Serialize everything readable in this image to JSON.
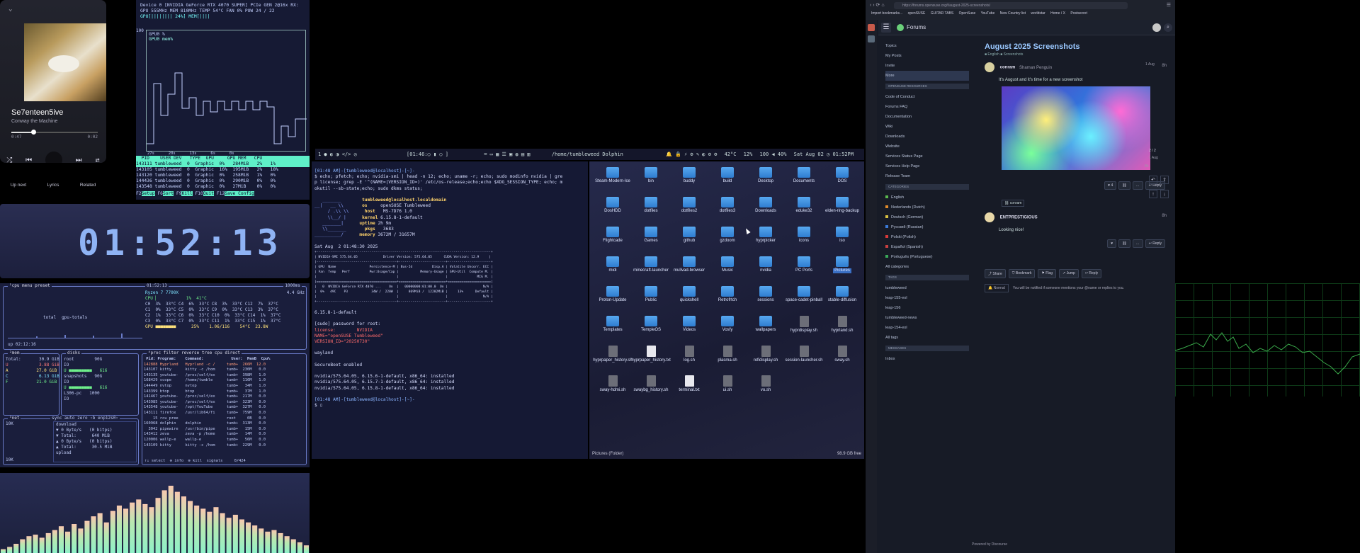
{
  "music": {
    "chevron": "⌄",
    "title": "Se7enteen5ive",
    "artist": "Conway the Machine",
    "elapsed": "0:47",
    "duration": "0:02",
    "progress": 0.25,
    "tabs": [
      "Up next",
      "Lyrics",
      "Related"
    ]
  },
  "nvtop": {
    "device": "Device 0 [NVIDIA GeForce RTX 4070 SUPER] PCIe GEN 2@16x RX:",
    "stats": "GPU 555MHz  MEM 810MHz  TEMP  54°C  FAN   0%  POW  24 / 22",
    "gpubar": "GPU[||||||||                    24%] MEM[||||",
    "ymax": "100",
    "legend1": "GPU0 %",
    "legend2": "GPU0 mem%",
    "xlabels": "27s      20s      13s      6s      0s",
    "header": "  PID    USER DEV   TYPE  GPU     GPU MEM   CPU",
    "rows": [
      "143111 tumbleweed  0  Graphic  0%   284MiB   2%   1%",
      "143105 tumbleweed  0  Graphic  16%  195MiB   2%   18%",
      "143120 tumbleweed  0  Graphic  0%   258MiB   1%   0%",
      "144436 tumbleweed  0  Graphic  0%   290MiB   0%   0%",
      "143548 tumbleweed  0  Graphic  0%   27MiB    0%   0%"
    ],
    "keys": [
      "Setup",
      "Sort",
      "Kill",
      "Quit",
      "Save Config"
    ]
  },
  "clock": {
    "time": "01:52:13"
  },
  "btop": {
    "cpu_label": "¹cpu menu preset",
    "clock": "01:52:13",
    "interval": "1000ms",
    "cpu_model": "Ryzen 7 7700X",
    "freq": "4.4 GHz",
    "cores": [
      "CPU ▏           1%  41°C",
      "C0  3%  33°C C4  6%  33°C C8  3%  33°C C12  7%  37°C",
      "C1  0%  33°C C5  0%  33°C C9  0%  33°C C13  3%  37°C",
      "C2  1%  33°C C6  0%  33°C C10  0%  33°C C14  1%  37°C",
      "C3  0%  33°C C7  0%  33°C C11  1%  33°C C15  1%  37°C"
    ],
    "gpu_line": "GPU ■■■■■■■■      25%    1.06/116    54°C  23.8W",
    "uptime": "up 02:12:16",
    "total_label": "total",
    "gpu_total": "gpu-totals",
    "mem_label": "²mem",
    "mem_rows": [
      "Total:       30.9 GiB",
      "U            3.88 GiB",
      "A           27.0 GiB",
      "C            6.13 GiB",
      "F           21.0 GiB"
    ],
    "disks_label": "disks",
    "disk_rows": [
      "root        90G",
      "IO",
      "U ■■■■■■■■■   616",
      "snapshots   90G",
      "IO",
      "U ■■■■■■■■■   616",
      "L306-pc   1000",
      "IO"
    ],
    "proc_label": "⁴proc filter reverse tree cpu direct",
    "proc_header": " Pid: Program:    Command:            User:  MemB  Cpu%",
    "proc_rows": [
      "142888 Hyprland   Hyprland -c /     tumb+  266M  12.0",
      "143107 kitty      kitty -c /hom     tumb+  230M   0.0",
      "143135 youtube-   /proc/self/ex     tumb+  398M   1.0",
      "168429 scope      /home/tumble      tumb+  116M   1.0",
      "144449 nvtop      nvtop             tumb+   34M   1.0",
      "143399 btop       btop              tumb+   37M   1.0",
      "141467 youtube-   /proc/self/ex     tumb+  217M   0.0",
      "143985 youtube-   /proc/self/ex     tumb+  323M   0.0",
      "143548 youtube-   /opt/YouTube      tumb+  327M   0.0",
      "143111 firefox    /usr/lib64/fi     tumb+  759M   0.0",
      "    15 rcu_pree                     root     0B   0.0",
      "160968 dolphin    dolphin           tumb+  313M   0.0",
      "  3042 pipewire   /usr/bin/pipe     tumb+   15M   0.0",
      "143412 zeva       zeva -p /home     tumb+   14M   0.0",
      "120006 wallp-e    wallp-e           tumb+   56M   0.0",
      "143109 kitty      kitty -c /hom     tumb+  229M   0.0"
    ],
    "proc_footer": "↑↓ select  ⊕ info  ⊗ kill  signals     0/424",
    "net_label": "³net",
    "net_opts": "sync auto zero ‹b enp12s0›",
    "net_rows": [
      "download",
      "▼ 0 Byte/s   (0 bitps)",
      "▼ Total:      640 MiB",
      "",
      "▲ 0 Byte/s   (0 bitps)",
      "▲ Total:      30.5 MiB",
      "upload"
    ],
    "net_scale_top": "10K",
    "net_scale_bot": "10K"
  },
  "viz": {
    "bars": [
      0.05,
      0.08,
      0.12,
      0.18,
      0.22,
      0.24,
      0.2,
      0.26,
      0.3,
      0.35,
      0.28,
      0.38,
      0.32,
      0.42,
      0.48,
      0.52,
      0.4,
      0.55,
      0.62,
      0.58,
      0.66,
      0.7,
      0.64,
      0.6,
      0.72,
      0.82,
      0.88,
      0.8,
      0.74,
      0.68,
      0.62,
      0.58,
      0.54,
      0.6,
      0.52,
      0.46,
      0.5,
      0.44,
      0.4,
      0.36,
      0.32,
      0.28,
      0.3,
      0.26,
      0.22,
      0.18,
      0.14,
      0.1
    ]
  },
  "waybar": {
    "workspaces": "1 ● ◐ ◑ </> ◎",
    "clock_small": "[01:46:○ ▮ ○ ]",
    "title": "/home/tumbleweed Dolphin",
    "cpu_temp": "42°C",
    "cpu_load": "12%",
    "volume": "100 ◀ 40%",
    "date": "Sat Aug 02 ◷ 01:52PM"
  },
  "term": {
    "prompt1": "[01:48 AM]-[tumbleweed@localhost]-[~]-",
    "cmd1": "$ echo; pfetch; echo; nvidia-smi | head -n 12; echo; uname -r; echo; sudo modinfo nvidia | gre",
    "cmd2": "p license; grep -E '^(NAME=|VERSION_ID=)' /etc/os-release;echo;echo $XDG_SESSION_TYPE; echo; m",
    "cmd3": "okutil --sb-state;echo; sudo dkms status;",
    "userhost": "tumbleweed@localhost.localdomain",
    "pfetch": [
      [
        "os",
        "openSUSE Tumbleweed"
      ],
      [
        "host",
        "MS-7D76 1.0"
      ],
      [
        "kernel",
        "6.15.8-1-default"
      ],
      [
        "uptime",
        "2h 9m"
      ],
      [
        "pkgs",
        "3683"
      ],
      [
        "memory",
        "3672M / 31657M"
      ]
    ],
    "date": "Sat Aug  2 01:48:30 2025",
    "smi": [
      "+-----------------------------------------------------------------------------------------+",
      "| NVIDIA-SMI 575.64.05             Driver Version: 575.64.05      CUDA Version: 12.9     |",
      "|-----------------------------------------+------------------------+----------------------+",
      "| GPU  Name                 Persistence-M | Bus-Id          Disp.A | Volatile Uncorr. ECC |",
      "| Fan  Temp   Perf          Pwr:Usage/Cap |           Memory-Usage | GPU-Util  Compute M. |",
      "|                                         |                        |               MIG M. |",
      "|=========================================+========================+======================|",
      "|   0  NVIDIA GeForce RTX 4070 ...    On  |   00000000:01:00.0  On |                  N/A |",
      "|  0%   49C    P3            34W /  220W  |     869MiB /  12282MiB |     13%      Default |",
      "|                                         |                        |                  N/A |",
      "+-----------------------------------------+------------------------+----------------------+"
    ],
    "uname": "6.15.8-1-default",
    "sudo": "[sudo] password for root:",
    "license": "license:        NVIDIA",
    "name": "NAME=\"openSUSE Tumbleweed\"",
    "version": "VERSION_ID=\"20250730\"",
    "session": "wayland",
    "secureboot": "SecureBoot enabled",
    "dkms": [
      "nvidia/575.64.05, 6.15.6-1-default, x86_64: installed",
      "nvidia/575.64.05, 6.15.7-1-default, x86_64: installed",
      "nvidia/575.64.05, 6.15.8-1-default, x86_64: installed"
    ],
    "prompt2": "[01:48 AM]-[tumbleweed@localhost]-[~]-",
    "cursor": "$ ▯"
  },
  "dolphin": {
    "items": [
      {
        "name": "Steam-Modern-Ice",
        "kind": "folder"
      },
      {
        "name": "bin",
        "kind": "folder"
      },
      {
        "name": "buddy",
        "kind": "folder"
      },
      {
        "name": "build",
        "kind": "folder"
      },
      {
        "name": "Desktop",
        "kind": "folder"
      },
      {
        "name": "Documents",
        "kind": "folder"
      },
      {
        "name": "DOS",
        "kind": "folder"
      },
      {
        "name": "DosHDD",
        "kind": "folder"
      },
      {
        "name": "dotfiles",
        "kind": "folder"
      },
      {
        "name": "dotfiles2",
        "kind": "folder"
      },
      {
        "name": "dotfiles3",
        "kind": "folder"
      },
      {
        "name": "Downloads",
        "kind": "folder"
      },
      {
        "name": "eduke32",
        "kind": "folder"
      },
      {
        "name": "elden-ring-backup",
        "kind": "folder"
      },
      {
        "name": "Flightcade",
        "kind": "folder"
      },
      {
        "name": "Games",
        "kind": "folder"
      },
      {
        "name": "github",
        "kind": "folder"
      },
      {
        "name": "gzdoom",
        "kind": "folder"
      },
      {
        "name": "hyprpicker",
        "kind": "folder"
      },
      {
        "name": "icons",
        "kind": "folder"
      },
      {
        "name": "iso",
        "kind": "folder"
      },
      {
        "name": "midi",
        "kind": "folder"
      },
      {
        "name": "minecraft-launcher",
        "kind": "folder"
      },
      {
        "name": "mullvad-browser",
        "kind": "folder"
      },
      {
        "name": "Music",
        "kind": "folder"
      },
      {
        "name": "nvidia",
        "kind": "folder"
      },
      {
        "name": "PC Ports",
        "kind": "folder"
      },
      {
        "name": "Pictures",
        "kind": "folder",
        "selected": true
      },
      {
        "name": "Proton-Update",
        "kind": "folder"
      },
      {
        "name": "Public",
        "kind": "folder"
      },
      {
        "name": "quickshell",
        "kind": "folder"
      },
      {
        "name": "Retrofrtch",
        "kind": "folder"
      },
      {
        "name": "sessions",
        "kind": "folder"
      },
      {
        "name": "space-cadet-pinball",
        "kind": "folder"
      },
      {
        "name": "stable-diffusion",
        "kind": "folder"
      },
      {
        "name": "Templates",
        "kind": "folder"
      },
      {
        "name": "TempleOS",
        "kind": "folder"
      },
      {
        "name": "Videos",
        "kind": "folder"
      },
      {
        "name": "Vosfy",
        "kind": "folder"
      },
      {
        "name": "wallpapers",
        "kind": "folder"
      },
      {
        "name": "hyprdisplay.sh",
        "kind": "file"
      },
      {
        "name": "hyprland.sh",
        "kind": "file"
      },
      {
        "name": "hyprpaper_history.sh",
        "kind": "file"
      },
      {
        "name": "hyprpaper_history.txt",
        "kind": "txt"
      },
      {
        "name": "log.sh",
        "kind": "file"
      },
      {
        "name": "plasma.sh",
        "kind": "file"
      },
      {
        "name": "rofidisplay.sh",
        "kind": "file"
      },
      {
        "name": "session-launcher.sh",
        "kind": "file"
      },
      {
        "name": "sway.sh",
        "kind": "file"
      },
      {
        "name": "sway-hdmi.sh",
        "kind": "file"
      },
      {
        "name": "swaybg_history.sh",
        "kind": "file"
      },
      {
        "name": "terminal.txt",
        "kind": "txt"
      },
      {
        "name": "ui.sh",
        "kind": "file"
      },
      {
        "name": "vo.sh",
        "kind": "file"
      }
    ],
    "status_left": "Pictures (Folder)",
    "status_right": "98.9 GB free"
  },
  "browser": {
    "url": "https://forums.opensuse.org/t/august-2025-screenshots/",
    "bookmarks": [
      "Import bookmarks...",
      "openSUSE",
      "GUITAR TABS",
      "OpenSuse",
      "YouTube",
      "New Country list",
      "worldstar",
      "Home / X",
      "Postsecret"
    ],
    "site": "Forums",
    "side_top": [
      "Topics",
      "My Posts",
      "Invite",
      "More"
    ],
    "sec_resources": "OPENSUSE RESOURCES",
    "resources": [
      "Code of Conduct",
      "Forums FAQ",
      "Documentation",
      "Wiki",
      "Downloads",
      "Website",
      "Services Status Page",
      "Services Help Page",
      "Release Team"
    ],
    "sec_categories": "CATEGORIES",
    "categories": [
      {
        "name": "English",
        "color": "#5ab84e"
      },
      {
        "name": "Nederlands (Dutch)",
        "color": "#e08a2a"
      },
      {
        "name": "Deutsch (German)",
        "color": "#d8c040"
      },
      {
        "name": "Русский (Russian)",
        "color": "#3a7ad8"
      },
      {
        "name": "Polski (Polish)",
        "color": "#d83a3a"
      },
      {
        "name": "Español (Spanish)",
        "color": "#c84040"
      },
      {
        "name": "Português (Portuguese)",
        "color": "#3aa858"
      },
      {
        "name": "All categories",
        "color": ""
      }
    ],
    "sec_tags": "TAGS",
    "tags": [
      "tumbleweed",
      "leap-155-eol",
      "leap-156",
      "tumbleweed-news",
      "leap-154-eol",
      "All tags"
    ],
    "sec_messages": "MESSAGES",
    "messages": [
      "Inbox"
    ],
    "topic_title": "August 2025 Screenshots",
    "topic_tags": "■ English  ■ Screenshots",
    "post1_user": "conram",
    "post1_fullname": "Shaman Penguin",
    "post1_age": "8h",
    "post1_text": "It's August and it's time for a new screenshot",
    "post1_date": "1 Aug",
    "timeline_pos": "2 / 2",
    "timeline_date": "1 Aug",
    "timeline_age": "8h",
    "post2_user": "ENTPRESTIGIOUS",
    "post2_age": "8h",
    "post2_text": "Looking nice!",
    "post_btns": [
      "♥ 4",
      "⛓",
      "…",
      "↩ Reply"
    ],
    "post2_btns": [
      "♥",
      "⛓",
      "…",
      "↩ Reply"
    ],
    "reply_ref": "⛓ conram",
    "foot_btns": [
      "⤴ Share",
      "⛉ Bookmark",
      "⚑ Flag",
      "↗ Jump",
      "↩ Reply"
    ],
    "notify_level": "🔔 Normal",
    "notify_text": "You will be notified if someone mentions your @name or replies to you.",
    "powered": "Powered by Discourse"
  }
}
